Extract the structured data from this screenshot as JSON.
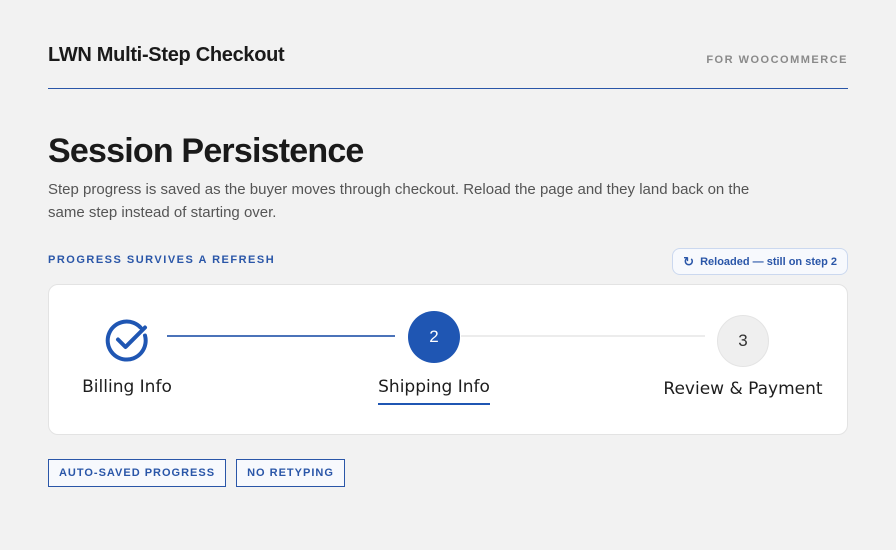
{
  "header": {
    "title": "LWN Multi-Step Checkout",
    "tag": "FOR WOOCOMMERCE"
  },
  "main": {
    "title": "Session Persistence",
    "description": "Step progress is saved as the buyer moves through checkout. Reload the page and they land back on the same step instead of starting over.",
    "section_label": "PROGRESS SURVIVES A REFRESH",
    "reload_badge": {
      "icon": "refresh-icon",
      "text": "Reloaded — still on step 2"
    }
  },
  "steps": [
    {
      "label": "Billing Info",
      "state": "complete",
      "icon": "check-circle-icon"
    },
    {
      "number": "2",
      "label": "Shipping Info",
      "state": "active"
    },
    {
      "number": "3",
      "label": "Review & Payment",
      "state": "pending"
    }
  ],
  "pills": [
    "AUTO-SAVED PROGRESS",
    "NO RETYPING"
  ],
  "colors": {
    "accent": "#1f56b3",
    "accent_text": "#2a56a8",
    "background": "#f2f2f2",
    "card": "#ffffff",
    "pending_step": "#efefef"
  }
}
